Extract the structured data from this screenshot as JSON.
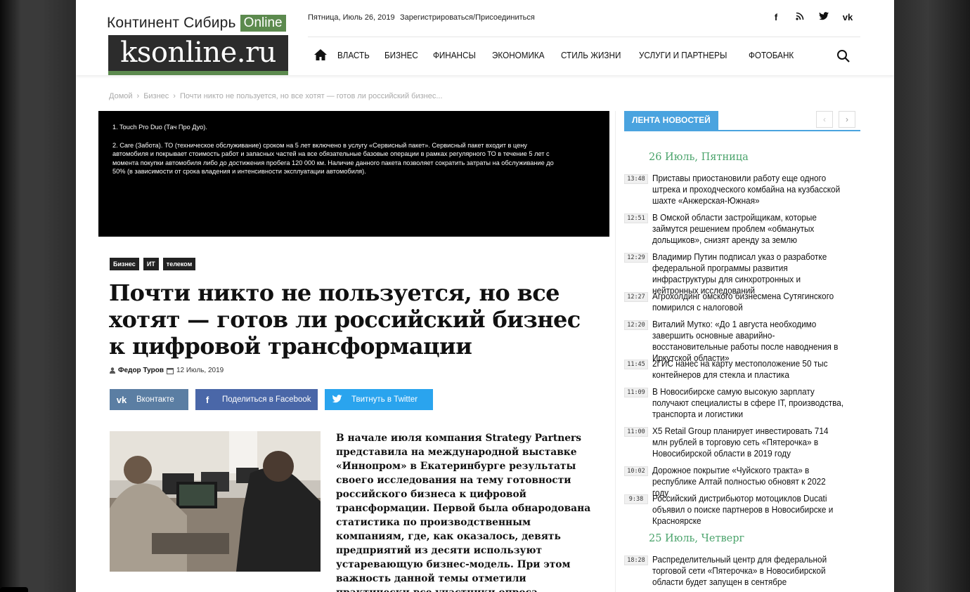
{
  "header": {
    "logo_top": "Континент Сибирь",
    "logo_online": "Online",
    "logo_main": "ksonline.ru",
    "date": "Пятница, Июль 26, 2019",
    "register": "Зарегистрироваться/Присоединиться",
    "social": [
      "f",
      "rss",
      "twitter",
      "vk"
    ],
    "nav": [
      "ВЛАСТЬ",
      "БИЗНЕС",
      "ФИНАНСЫ",
      "ЭКОНОМИКА",
      "СТИЛЬ ЖИЗНИ",
      "УСЛУГИ И ПАРТНЕРЫ",
      "ФОТОБАНК"
    ]
  },
  "breadcrumb": {
    "home": "Домой",
    "section": "Бизнес",
    "current": "Почти никто не пользуется, но все хотят — готов ли российский бизнес..."
  },
  "banner": {
    "line1": "1. Touch Pro Duo (Тач Про Дуо).",
    "line2": "2. Care (Забота). ТО (техническое обслуживание) сроком на 5 лет включено в услугу «Сервисный пакет». Сервисный пакет входит в цену автомобиля и покрывает стоимость работ и запасных частей на все обязательные базовые операции в рамках регулярного ТО в течение 5 лет с момента покупки автомобиля либо до достижения пробега 120 000 км. Наличие данного пакета позволяет сократить затраты на обслуживание до 50% (в зависимости от срока владения и интенсивности эксплуатации автомобиля)."
  },
  "article": {
    "tags": [
      "Бизнес",
      "ИТ",
      "телеком"
    ],
    "title": "Почти никто не пользуется, но все хотят — готов ли российский бизнес к цифровой трансформации",
    "author": "Федор Туров",
    "date": "12 Июль, 2019",
    "share_vk": "Вконтакте",
    "share_fb": "Поделиться в Facebook",
    "share_tw": "Твитнуть в Twitter",
    "lead": "В начале июля компания Strategy Partners представила на международной выставке «Иннопром» в Екатеринбурге результаты своего исследования на тему готовности российского бизнеса к цифровой трансформации. Первой была обнародована статистика по производственным компаниям, где, как оказалось, девять предприятий из десяти используют устаревающую бизнес-модель. При этом важность данной темы отметили практически все участники опроса."
  },
  "sidebar": {
    "title": "ЛЕНТА НОВОСТЕЙ",
    "day1": "26 Июль, Пятница",
    "day2": "25 Июль, Четверг",
    "news": [
      {
        "time": "13:48",
        "text": "Приставы приостановили работу еще одного штрека и проходческого комбайна на кузбасской шахте «Анжерская-Южная»"
      },
      {
        "time": "12:51",
        "text": "В Омской области застройщикам, которые займутся решением проблем «обманутых дольщиков», снизят аренду за землю"
      },
      {
        "time": "12:29",
        "text": "Владимир Путин подписал указ о разработке федеральной программы развития инфраструктуры для синхротронных и нейтронных исследований"
      },
      {
        "time": "12:27",
        "text": "Агрохолдинг омского бизнесмена Сутягинского помирился с налоговой"
      },
      {
        "time": "12:20",
        "text": "Виталий Мутко: «До 1 августа необходимо завершить основные аварийно-восстановительные работы после наводнения в Иркутской области»"
      },
      {
        "time": "11:45",
        "text": "2ГИС нанес на карту местоположение 50 тыс контейнеров для стекла и пластика"
      },
      {
        "time": "11:09",
        "text": "В Новосибирске самую высокую зарплату получают специалисты в сфере IT, производства, транспорта и логистики"
      },
      {
        "time": "11:00",
        "text": "X5 Retail Group планирует инвестировать 714 млн рублей в торговую сеть «Пятерочка» в Новосибирской области в 2019 году"
      },
      {
        "time": "10:02",
        "text": "Дорожное покрытие «Чуйского тракта» в республике Алтай полностью обновят к 2022 году"
      },
      {
        "time": "9:38",
        "text": "Российский дистрибьютор мотоциклов Ducati объявил о поиске партнеров в Новосибирске и Красноярске"
      },
      {
        "time": "18:28",
        "text": "Распределительный центр для федеральной торговой сети «Пятерочка» в Новосибирской области будет запущен в сентябре"
      }
    ]
  }
}
